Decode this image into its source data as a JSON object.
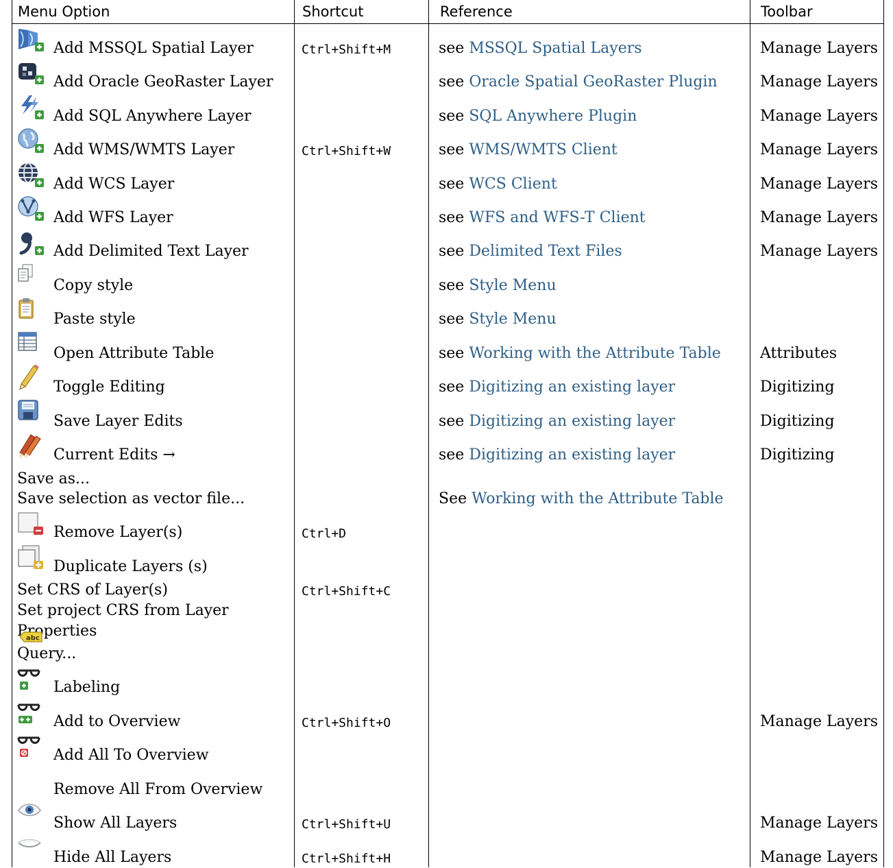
{
  "headers": {
    "menu_option": "Menu Option",
    "shortcut": "Shortcut",
    "reference": "Reference",
    "toolbar": "Toolbar"
  },
  "rows": [
    {
      "icon": "mssql-layer-icon",
      "menu": "Add MSSQL Spatial Layer",
      "shortcut": "Ctrl+Shift+M",
      "ref_prefix": "see",
      "ref_link": "MSSQL Spatial Layers",
      "toolbar": "Manage Layers"
    },
    {
      "icon": "oracle-georaster-icon",
      "menu": "Add Oracle GeoRaster Layer",
      "shortcut": "",
      "ref_prefix": "see",
      "ref_link": "Oracle Spatial GeoRaster Plugin",
      "toolbar": "Manage Layers"
    },
    {
      "icon": "sql-anywhere-icon",
      "menu": "Add SQL Anywhere Layer",
      "shortcut": "",
      "ref_prefix": "see",
      "ref_link": "SQL Anywhere Plugin",
      "toolbar": "Manage Layers"
    },
    {
      "icon": "wms-wmts-icon",
      "menu": "Add WMS/WMTS Layer",
      "shortcut": "Ctrl+Shift+W",
      "ref_prefix": "see",
      "ref_link": "WMS/WMTS Client",
      "toolbar": "Manage Layers"
    },
    {
      "icon": "wcs-globe-icon",
      "menu": "Add WCS Layer",
      "shortcut": "",
      "ref_prefix": "see",
      "ref_link": "WCS Client",
      "toolbar": "Manage Layers"
    },
    {
      "icon": "wfs-icon",
      "menu": "Add WFS Layer",
      "shortcut": "",
      "ref_prefix": "see",
      "ref_link": "WFS and WFS-T Client",
      "toolbar": "Manage Layers"
    },
    {
      "icon": "delimited-text-icon",
      "menu": "Add Delimited Text Layer",
      "shortcut": "",
      "ref_prefix": "see",
      "ref_link": "Delimited Text Files",
      "toolbar": "Manage Layers"
    },
    {
      "icon": "copy-style-icon",
      "menu": "Copy style",
      "shortcut": "",
      "ref_prefix": "see",
      "ref_link": "Style Menu",
      "toolbar": ""
    },
    {
      "icon": "paste-style-icon",
      "menu": "Paste style",
      "shortcut": "",
      "ref_prefix": "see",
      "ref_link": "Style Menu",
      "toolbar": ""
    },
    {
      "icon": "attribute-table-icon",
      "menu": "Open Attribute Table",
      "shortcut": "",
      "ref_prefix": "see",
      "ref_link": "Working with the Attribute Table",
      "toolbar": "Attributes"
    },
    {
      "icon": "pencil-icon",
      "menu": "Toggle Editing",
      "shortcut": "",
      "ref_prefix": "see",
      "ref_link": "Digitizing an existing layer",
      "toolbar": "Digitizing"
    },
    {
      "icon": "save-edits-icon",
      "menu": "Save Layer Edits",
      "shortcut": "",
      "ref_prefix": "see",
      "ref_link": "Digitizing an existing layer",
      "toolbar": "Digitizing"
    },
    {
      "icon": "current-edits-icon",
      "menu": "Current Edits →",
      "shortcut": "",
      "ref_prefix": "see",
      "ref_link": "Digitizing an existing layer",
      "toolbar": "Digitizing"
    },
    {
      "icon": "",
      "menu": "Save as...",
      "shortcut": "",
      "ref_prefix": "",
      "ref_link": "",
      "toolbar": ""
    },
    {
      "icon": "",
      "menu": "Save selection as vector file...",
      "shortcut": "",
      "ref_prefix": "See",
      "ref_link": "Working with the Attribute Table",
      "toolbar": ""
    },
    {
      "icon": "remove-layer-icon",
      "menu": "Remove Layer(s)",
      "shortcut": "Ctrl+D",
      "ref_prefix": "",
      "ref_link": "",
      "toolbar": ""
    },
    {
      "icon": "duplicate-layer-icon",
      "menu": "Duplicate Layers (s)",
      "shortcut": "",
      "ref_prefix": "",
      "ref_link": "",
      "toolbar": ""
    },
    {
      "icon": "",
      "menu": "Set CRS of Layer(s)",
      "shortcut": "Ctrl+Shift+C",
      "ref_prefix": "",
      "ref_link": "",
      "toolbar": ""
    },
    {
      "icon": "",
      "menu": "Set project CRS from Layer",
      "shortcut": "",
      "ref_prefix": "",
      "ref_link": "",
      "toolbar": ""
    },
    {
      "icon": "",
      "menu": "Properties",
      "shortcut": "",
      "ref_prefix": "",
      "ref_link": "",
      "toolbar": ""
    },
    {
      "icon": "",
      "menu": "Query...",
      "shortcut": "",
      "ref_prefix": "",
      "ref_link": "",
      "toolbar": ""
    },
    {
      "icon": "labeling-abc-icon",
      "menu": "Labeling",
      "shortcut": "",
      "ref_prefix": "",
      "ref_link": "",
      "toolbar": ""
    },
    {
      "icon": "add-overview-icon",
      "menu": "Add to Overview",
      "shortcut": "Ctrl+Shift+O",
      "ref_prefix": "",
      "ref_link": "",
      "toolbar": "Manage Layers"
    },
    {
      "icon": "add-all-overview-icon",
      "menu": "Add All To Overview",
      "shortcut": "",
      "ref_prefix": "",
      "ref_link": "",
      "toolbar": ""
    },
    {
      "icon": "remove-all-overview-icon",
      "menu": "Remove All From Overview",
      "shortcut": "",
      "ref_prefix": "",
      "ref_link": "",
      "toolbar": ""
    },
    {
      "icon": "show-layers-eye-icon",
      "menu": "Show All Layers",
      "shortcut": "Ctrl+Shift+U",
      "ref_prefix": "",
      "ref_link": "",
      "toolbar": "Manage Layers"
    },
    {
      "icon": "hide-layers-eye-icon",
      "menu": "Hide All Layers",
      "shortcut": "Ctrl+Shift+H",
      "ref_prefix": "",
      "ref_link": "",
      "toolbar": "Manage Layers"
    }
  ],
  "colors": {
    "link": "#2f5f86",
    "rule": "#000000",
    "green_badge": "#3f9a3f",
    "red_badge": "#d23c3c"
  }
}
